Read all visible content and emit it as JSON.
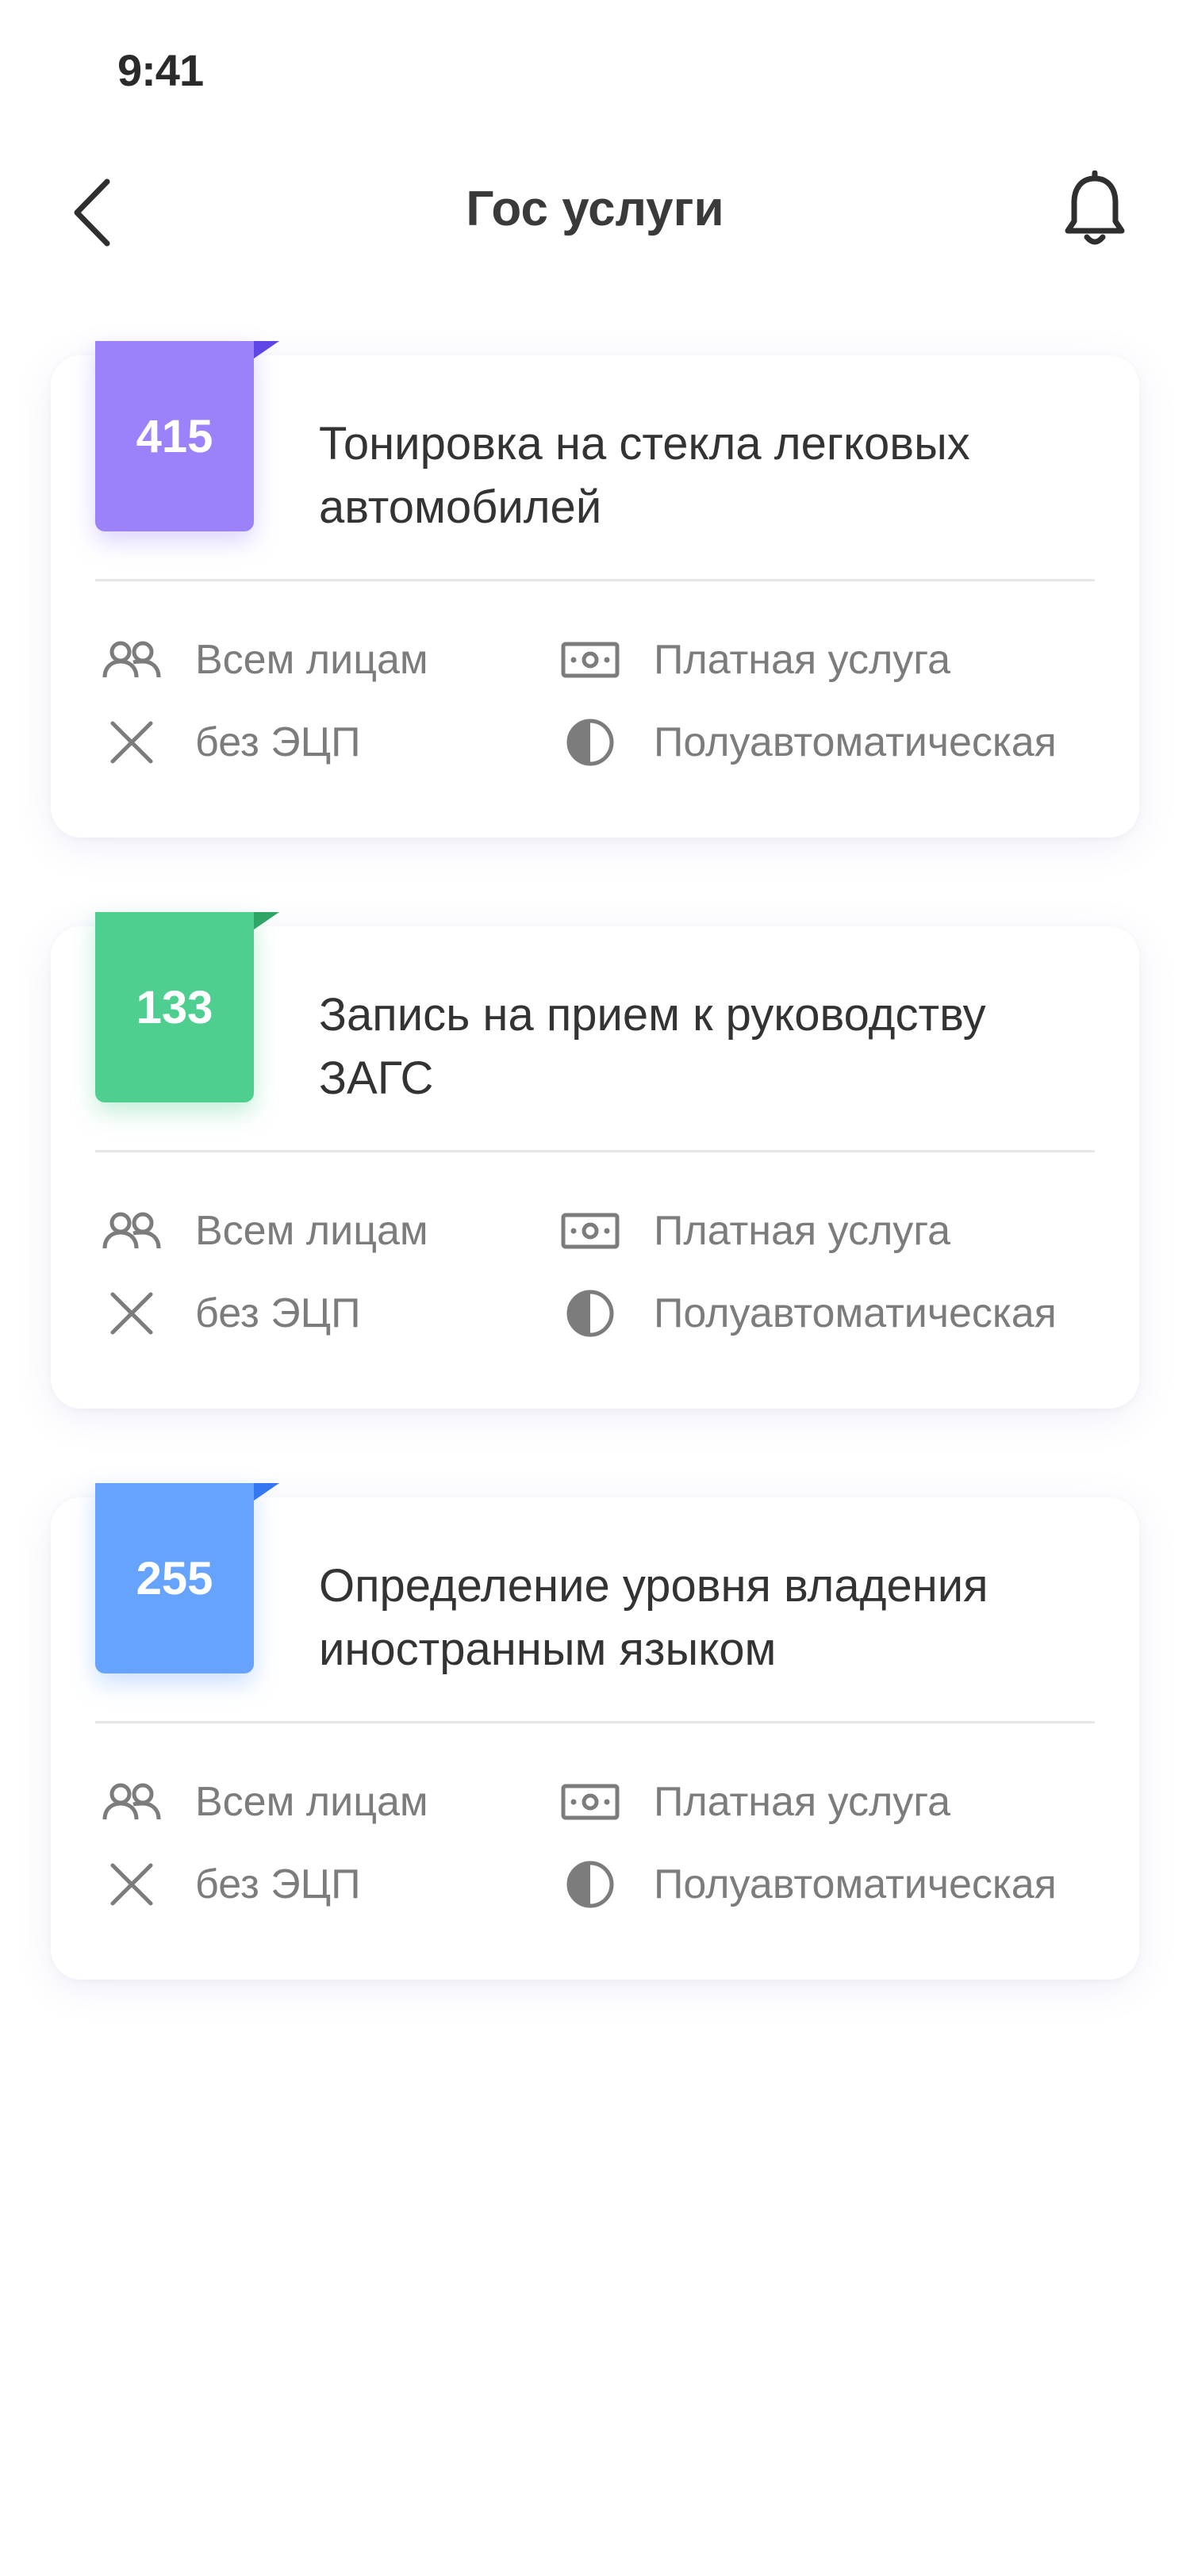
{
  "status_bar": {
    "time": "9:41"
  },
  "header": {
    "title": "Гос услуги"
  },
  "colors": {
    "purple": "#9b82fb",
    "purple_fold": "#5f45e6",
    "green": "#4fcf8f",
    "green_fold": "#2ea565",
    "blue": "#66a3ff",
    "blue_fold": "#3477f0",
    "icon": "#7c7c7c"
  },
  "services": [
    {
      "number": "415",
      "title": "Тонировка на стекла легковых автомобилей",
      "audience": "Всем лицам",
      "signature": "без ЭЦП",
      "payment": "Платная услуга",
      "mode": "Полуавтоматическая",
      "color": "purple"
    },
    {
      "number": "133",
      "title": "Запись на прием к руководству ЗАГС",
      "audience": "Всем лицам",
      "signature": "без ЭЦП",
      "payment": "Платная услуга",
      "mode": "Полуавтоматическая",
      "color": "green"
    },
    {
      "number": "255",
      "title": "Определение уровня владения иностранным языком",
      "audience": "Всем лицам",
      "signature": "без ЭЦП",
      "payment": "Платная услуга",
      "mode": "Полуавтоматическая",
      "color": "blue"
    }
  ]
}
